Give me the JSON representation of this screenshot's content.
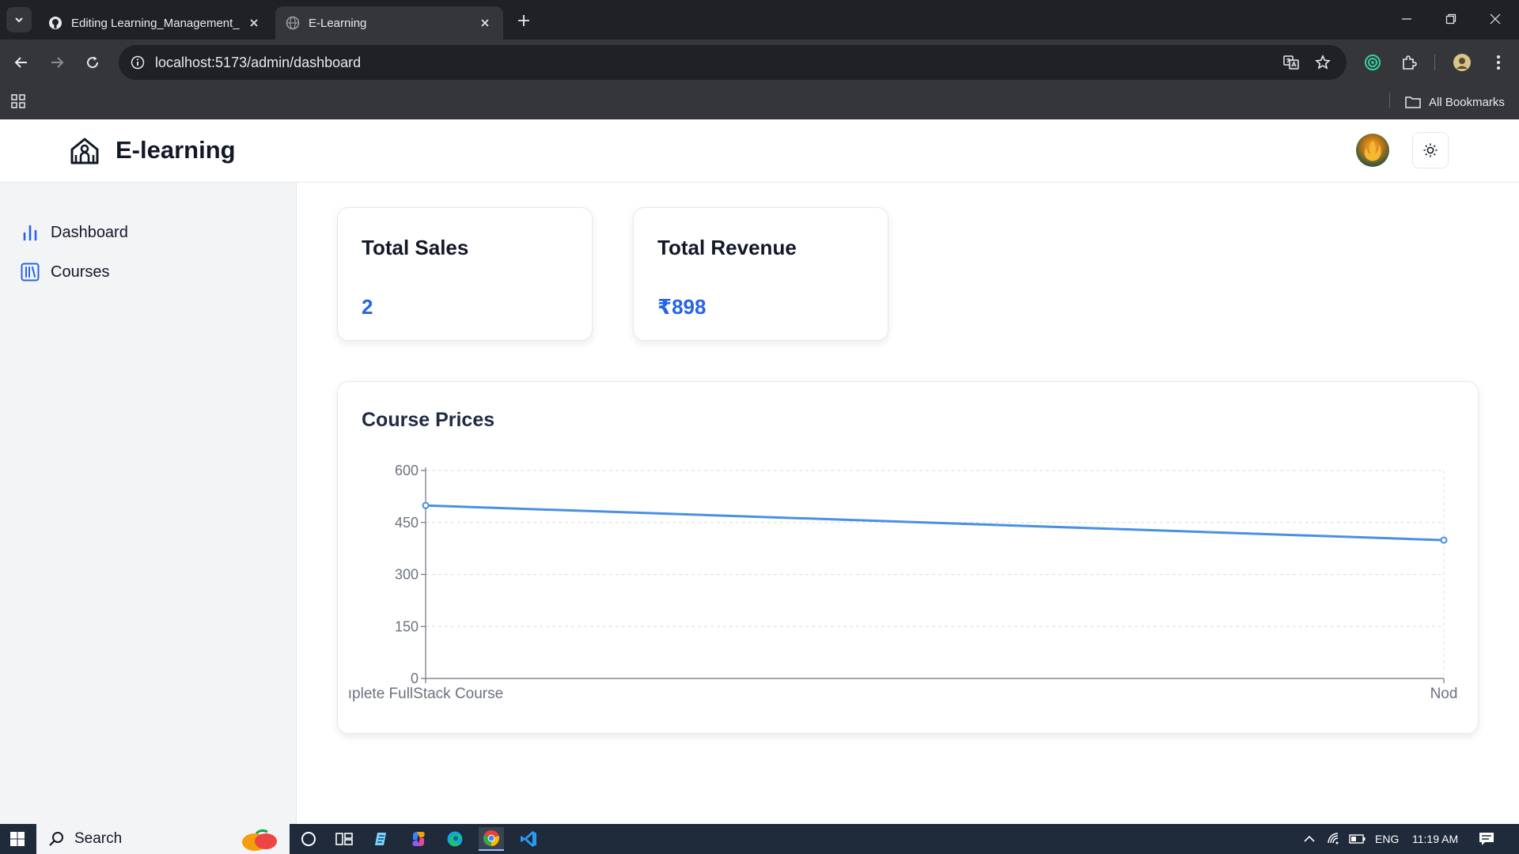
{
  "browser": {
    "tabs": [
      {
        "title": "Editing Learning_Management_",
        "active": false
      },
      {
        "title": "E-Learning",
        "active": true
      }
    ],
    "url": "localhost:5173/admin/dashboard",
    "bookmarks_label": "All Bookmarks"
  },
  "app": {
    "brand": "E-learning",
    "sidebar": [
      {
        "label": "Dashboard",
        "icon": "bar-chart-icon"
      },
      {
        "label": "Courses",
        "icon": "library-icon"
      }
    ],
    "cards": [
      {
        "title": "Total Sales",
        "value": "2"
      },
      {
        "title": "Total Revenue",
        "value": "₹898"
      }
    ],
    "chart_card_title": "Course Prices",
    "colors": {
      "accent": "#2563eb",
      "line": "#4a90e2"
    }
  },
  "chart_data": {
    "type": "line",
    "title": "Course Prices",
    "categories": [
      "Complete FullStack Course",
      "Nod"
    ],
    "category_tick_labels": [
      "ıplete FullStack Course",
      "Nod"
    ],
    "series": [
      {
        "values": [
          499,
          399
        ]
      }
    ],
    "ylim": [
      0,
      600
    ],
    "yticks": [
      0,
      150,
      300,
      450,
      600
    ],
    "grid": true
  },
  "taskbar": {
    "search_label": "Search",
    "tray_lang": "ENG",
    "time": "11:19 AM"
  }
}
